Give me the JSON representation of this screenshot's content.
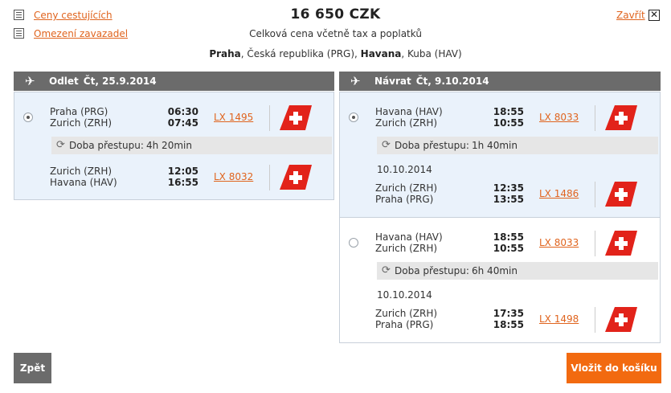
{
  "header": {
    "link_fare_rules": "Ceny cestujících",
    "link_restrictions": "Omezení zavazadel",
    "price": "16 650  CZK",
    "price_note": "Celková cena včetně tax a poplatků",
    "route": {
      "from_city": "Praha",
      "from_rest": ", Česká republika (PRG), ",
      "to_city": "Havana",
      "to_rest": ", Kuba (HAV)"
    },
    "close_label": "Zavřít",
    "close_x": "✕"
  },
  "outbound": {
    "title": "Odlet",
    "date": "Čt, 25.9.2014",
    "options": [
      {
        "selected": true,
        "segments": [
          {
            "from": "Praha (PRG)",
            "to": "Zurich (ZRH)",
            "dep": "06:30",
            "arr": "07:45",
            "flight": "LX 1495"
          },
          {
            "from": "Zurich (ZRH)",
            "to": "Havana (HAV)",
            "dep": "12:05",
            "arr": "16:55",
            "flight": "LX 8032"
          }
        ],
        "transfer": {
          "label": "Doba přestupu:",
          "value": "4h 20min"
        }
      }
    ]
  },
  "inbound": {
    "title": "Návrat",
    "date": "Čt, 9.10.2014",
    "options": [
      {
        "selected": true,
        "segments": [
          {
            "from": "Havana (HAV)",
            "to": "Zurich (ZRH)",
            "dep": "18:55",
            "arr": "10:55",
            "flight": "LX 8033"
          },
          {
            "from": "Zurich (ZRH)",
            "to": "Praha (PRG)",
            "dep": "12:35",
            "arr": "13:55",
            "flight": "LX 1486"
          }
        ],
        "transfer": {
          "label": "Doba přestupu:",
          "value": "1h 40min"
        },
        "date_change": "10.10.2014"
      },
      {
        "selected": false,
        "segments": [
          {
            "from": "Havana (HAV)",
            "to": "Zurich (ZRH)",
            "dep": "18:55",
            "arr": "10:55",
            "flight": "LX 8033"
          },
          {
            "from": "Zurich (ZRH)",
            "to": "Praha (PRG)",
            "dep": "17:35",
            "arr": "18:55",
            "flight": "LX 1498"
          }
        ],
        "transfer": {
          "label": "Doba přestupu:",
          "value": "6h 40min"
        },
        "date_change": "10.10.2014"
      }
    ]
  },
  "footer": {
    "back_label": "Zpět",
    "cart_label": "Vložit do košíku"
  },
  "colors": {
    "accent": "#f26a10",
    "link": "#e0641e",
    "panel_header": "#6b6b6b",
    "selected_bg": "#eaf2fb",
    "airline_red": "#e2231a"
  },
  "icons": {
    "document": "document-icon",
    "departure": "plane-takeoff-icon",
    "arrival": "plane-landing-icon",
    "transfer": "refresh-icon",
    "airline": "swiss-cross-logo"
  }
}
